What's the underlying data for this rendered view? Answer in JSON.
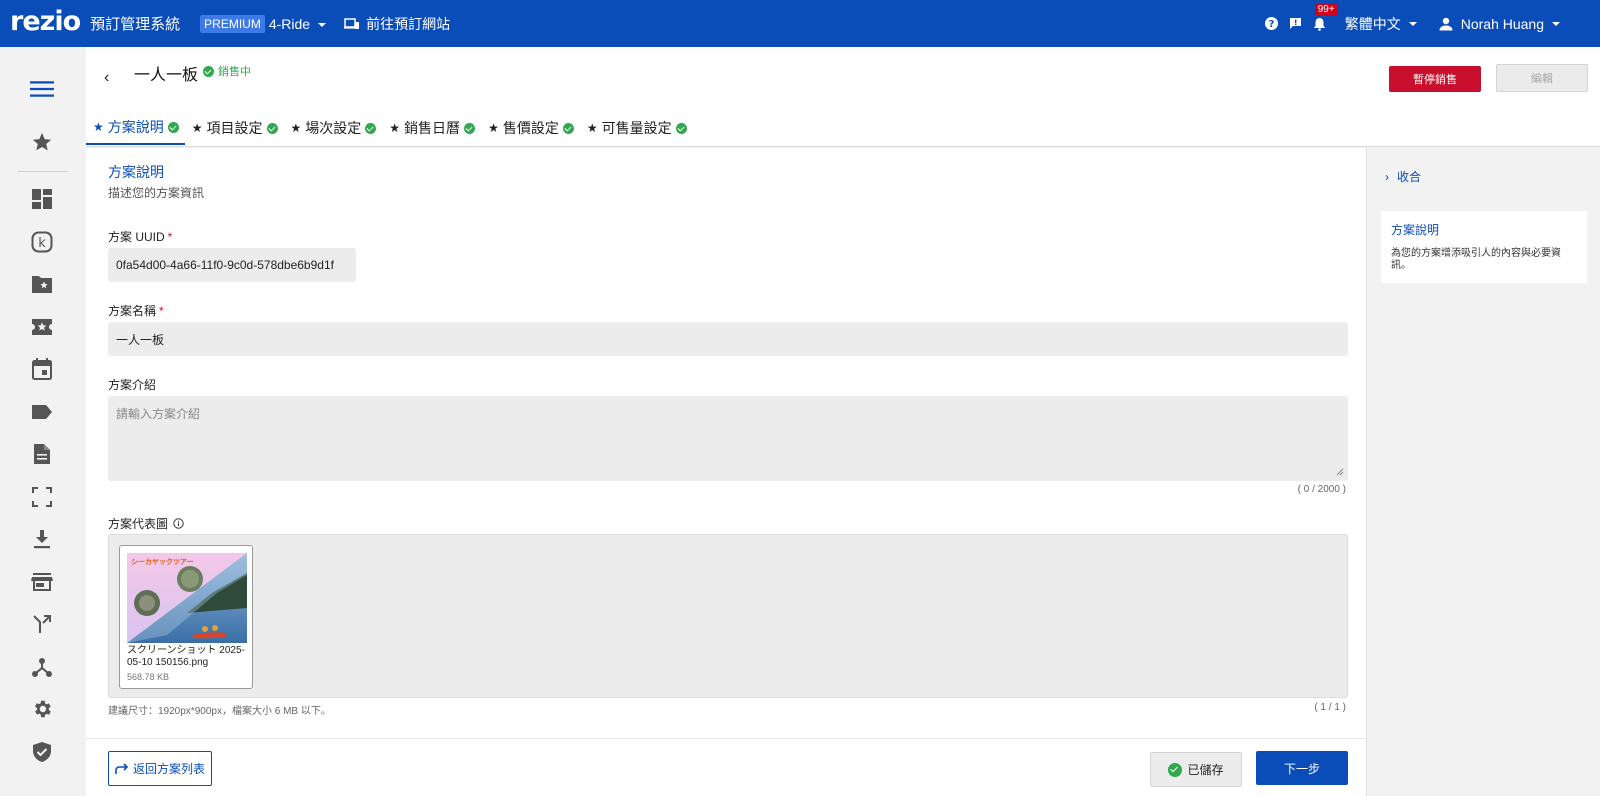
{
  "topbar": {
    "logo": "rezio",
    "system_title": "預訂管理系統",
    "plan_badge": "PREMIUM",
    "site_name": "4-Ride",
    "goto_site": "前往預訂網站",
    "notification_count": "99+",
    "language": "繁體中文",
    "user_name": "Norah Huang"
  },
  "header": {
    "back": "‹",
    "plan_title": "一人一板",
    "status": "銷售中",
    "pause_button": "暫停銷售",
    "edit_button": "編輯",
    "tabs": [
      {
        "label": "方案說明"
      },
      {
        "label": "項目設定"
      },
      {
        "label": "場次設定"
      },
      {
        "label": "銷售日曆"
      },
      {
        "label": "售價設定"
      },
      {
        "label": "可售量設定"
      }
    ]
  },
  "form": {
    "section_title": "方案說明",
    "section_desc": "描述您的方案資訊",
    "uuid_label": "方案 UUID",
    "uuid_value": "0fa54d00-4a66-11f0-9c0d-578dbe6b9d1f",
    "name_label": "方案名稱",
    "name_value": "一人一板",
    "intro_label": "方案介紹",
    "intro_placeholder": "請輸入方案介紹",
    "intro_counter": "( 0 / 2000 )",
    "image_label": "方案代表圖",
    "image_name": "スクリーンショット 2025-05-10 150156.png",
    "image_size": "568.78 KB",
    "image_caption": "シーカヤックツアー",
    "image_hint": "建議尺寸：1920px*900px，檔案大小 6 MB 以下。",
    "image_count": "( 1 / 1 )"
  },
  "footer": {
    "back_to_list": "返回方案列表",
    "saved": "已儲存",
    "next": "下一步"
  },
  "right_panel": {
    "collapse": "收合",
    "card_title": "方案說明",
    "card_body": "為您的方案增添吸引人的內容與必要資訊。"
  },
  "colors": {
    "brand": "#0a4db8",
    "danger": "#c8102e",
    "success": "#2fa84f"
  }
}
